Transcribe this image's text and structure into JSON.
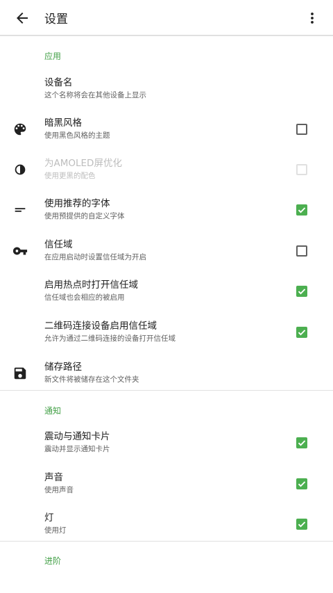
{
  "appbar": {
    "title": "设置",
    "back_icon": "arrow-back-icon",
    "more_icon": "more-vert-icon"
  },
  "sections": {
    "app": {
      "header": "应用"
    },
    "notify": {
      "header": "通知"
    },
    "advanced": {
      "header": "进阶"
    }
  },
  "prefs": {
    "device_name": {
      "title": "设备名",
      "summary": "这个名称将会在其他设备上显示"
    },
    "dark_style": {
      "title": "暗黑风格",
      "summary": "使用黑色风格的主题",
      "checked": false,
      "icon": "palette-icon"
    },
    "amoled": {
      "title": "为AMOLED屏优化",
      "summary": "使用更黑的配色",
      "checked": false,
      "enabled": false,
      "icon": "contrast-icon"
    },
    "font": {
      "title": "使用推荐的字体",
      "summary": "使用预提供的自定义字体",
      "checked": true,
      "icon": "short-text-icon"
    },
    "trust": {
      "title": "信任域",
      "summary": "在应用启动时设置信任域为开启",
      "checked": false,
      "icon": "key-icon"
    },
    "hotspot_trust": {
      "title": "启用热点时打开信任域",
      "summary": "信任域也会相应的被启用",
      "checked": true
    },
    "qr_trust": {
      "title": "二维码连接设备启用信任域",
      "summary": "允许为通过二维码连接的设备打开信任域",
      "checked": true
    },
    "storage": {
      "title": "储存路径",
      "summary": "新文件将被储存在这个文件夹",
      "icon": "save-icon"
    },
    "vibration": {
      "title": "震动与通知卡片",
      "summary": "震动并显示通知卡片",
      "checked": true
    },
    "sound": {
      "title": "声音",
      "summary": "使用声音",
      "checked": true
    },
    "light": {
      "title": "灯",
      "summary": "使用灯",
      "checked": true
    }
  },
  "colors": {
    "accent": "#43a047",
    "checkbox_on": "#4caf50",
    "divider": "#e0e0e0"
  }
}
